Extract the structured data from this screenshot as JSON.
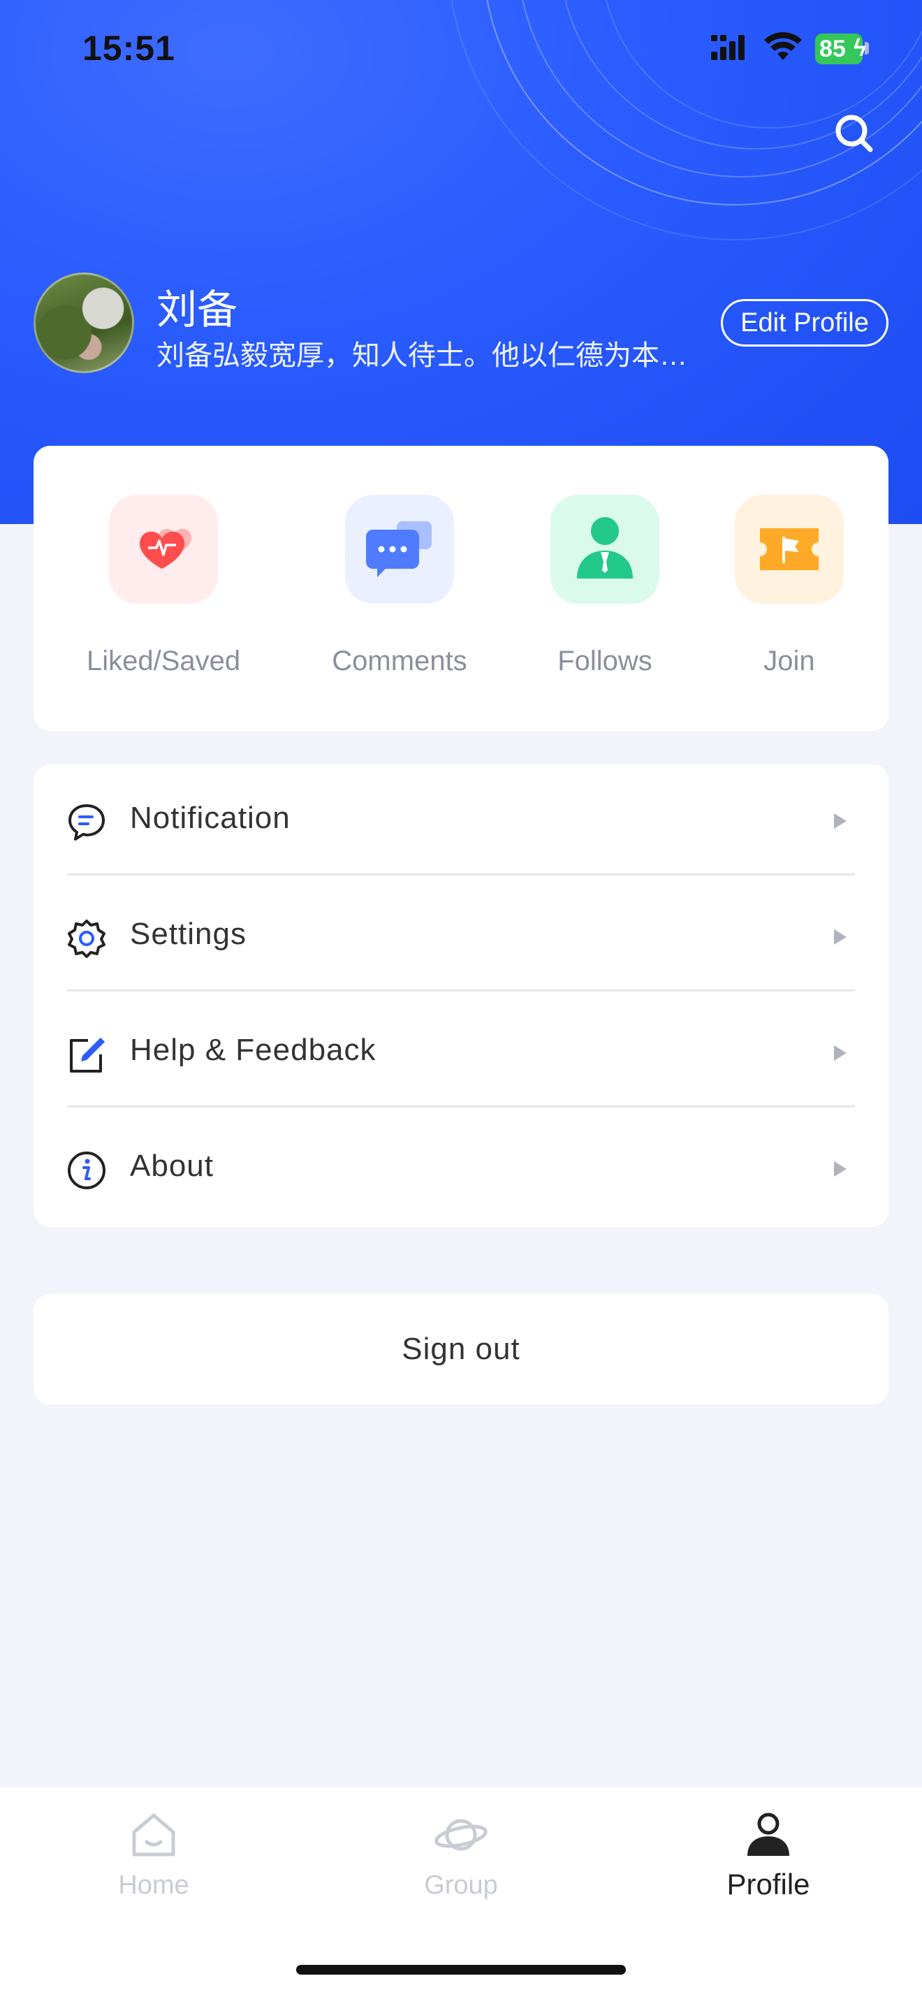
{
  "status_bar": {
    "time": "15:51",
    "battery": "85"
  },
  "profile": {
    "name": "刘备",
    "bio": "刘备弘毅宽厚，知人待士。他以仁德为本…",
    "edit_label": "Edit Profile"
  },
  "quick_actions": [
    {
      "label": "Liked/Saved",
      "icon": "heart-icon",
      "color": "#ff5a5a"
    },
    {
      "label": "Comments",
      "icon": "chat-bubbles-icon",
      "color": "#4f7cff"
    },
    {
      "label": "Follows",
      "icon": "person-icon",
      "color": "#22c98a"
    },
    {
      "label": "Join",
      "icon": "ticket-flag-icon",
      "color": "#ffa928"
    }
  ],
  "menu": [
    {
      "label": "Notification",
      "icon": "message-icon"
    },
    {
      "label": "Settings",
      "icon": "gear-icon"
    },
    {
      "label": "Help & Feedback",
      "icon": "edit-icon"
    },
    {
      "label": "About",
      "icon": "info-icon"
    }
  ],
  "sign_out_label": "Sign out",
  "tabs": [
    {
      "label": "Home",
      "icon": "home-icon",
      "active": false
    },
    {
      "label": "Group",
      "icon": "planet-icon",
      "active": false
    },
    {
      "label": "Profile",
      "icon": "user-icon",
      "active": true
    }
  ],
  "colors": {
    "accent": "#2a5cff",
    "page_bg": "#f3f4fb"
  }
}
